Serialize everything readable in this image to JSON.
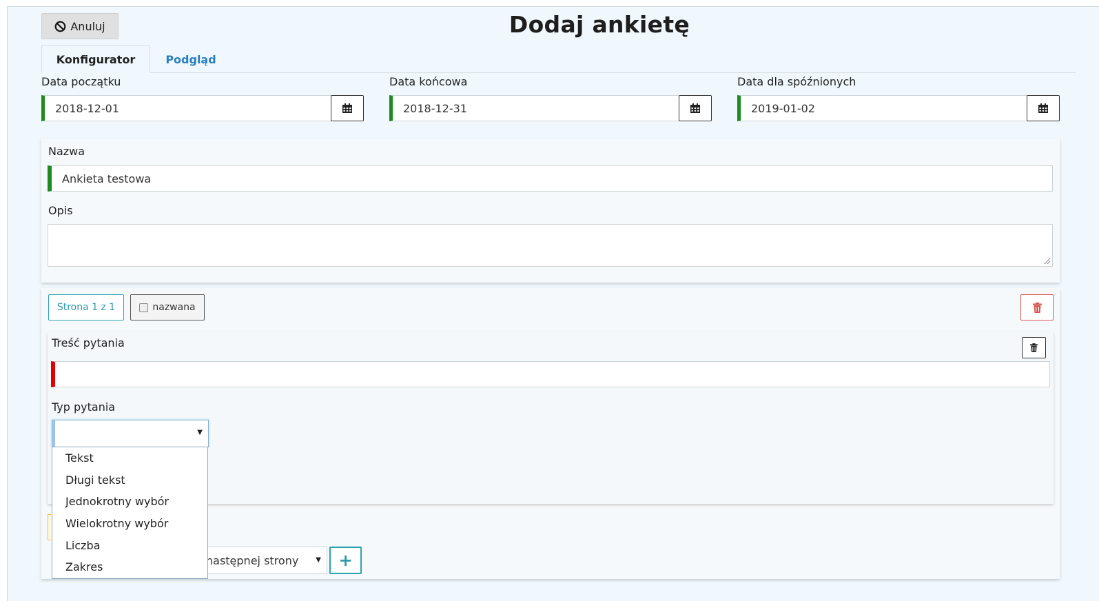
{
  "header": {
    "cancel_label": "Anuluj",
    "cancel_icon": "ban-icon",
    "title": "Dodaj ankietę"
  },
  "tabs": [
    {
      "label": "Konfigurator",
      "active": true
    },
    {
      "label": "Podgląd",
      "active": false
    }
  ],
  "dates": {
    "start": {
      "label": "Data początku",
      "value": "2018-12-01"
    },
    "end": {
      "label": "Data końcowa",
      "value": "2018-12-31"
    },
    "late": {
      "label": "Data dla spóźnionych",
      "value": "2019-01-02"
    },
    "icon": "calendar-icon"
  },
  "survey": {
    "name_label": "Nazwa",
    "name_value": "Ankieta testowa",
    "description_label": "Opis",
    "description_value": ""
  },
  "page": {
    "indicator": "Strona 1 z 1",
    "named_label": "nazwana",
    "named_checked": false
  },
  "question": {
    "content_label": "Treść pytania",
    "content_value": "",
    "type_label": "Typ pytania",
    "type_value": "",
    "type_options": [
      "Tekst",
      "Długi tekst",
      "Jednokrotny wybór",
      "Wielokrotny wybór",
      "Liczba",
      "Zakres"
    ]
  },
  "footer": {
    "next_select_partial": "następnej strony",
    "add_label": "+"
  },
  "colors": {
    "background": "#f0f8fd",
    "valid": "#1f8a1f",
    "invalid": "#e00000",
    "link": "#2b7fc1",
    "accent": "#2aa3b0",
    "danger": "#d9534f"
  }
}
